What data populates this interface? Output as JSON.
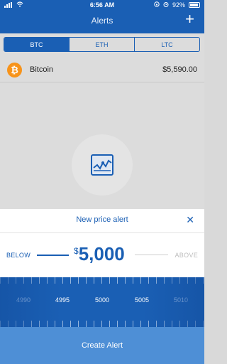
{
  "statusbar": {
    "time": "6:56 AM",
    "battery": "92%"
  },
  "header": {
    "title": "Alerts",
    "add_icon": "plus-icon"
  },
  "tabs": [
    {
      "label": "BTC",
      "active": true
    },
    {
      "label": "ETH",
      "active": false
    },
    {
      "label": "LTC",
      "active": false
    }
  ],
  "coin": {
    "name": "Bitcoin",
    "price": "$5,590.00",
    "icon": "bitcoin-icon",
    "icon_glyph": "₿",
    "icon_color": "#f7931a"
  },
  "empty_state_icon": "chart-icon",
  "sheet": {
    "title": "New price alert",
    "close_icon": "close-icon",
    "below_label": "BELOW",
    "above_label": "ABOVE",
    "currency_symbol": "$",
    "amount": "5,000",
    "ruler_labels": [
      "4990",
      "4995",
      "5000",
      "5005",
      "5010"
    ],
    "create_label": "Create Alert"
  },
  "colors": {
    "brand": "#1a5fb4",
    "create_button": "#4e8fd6"
  }
}
